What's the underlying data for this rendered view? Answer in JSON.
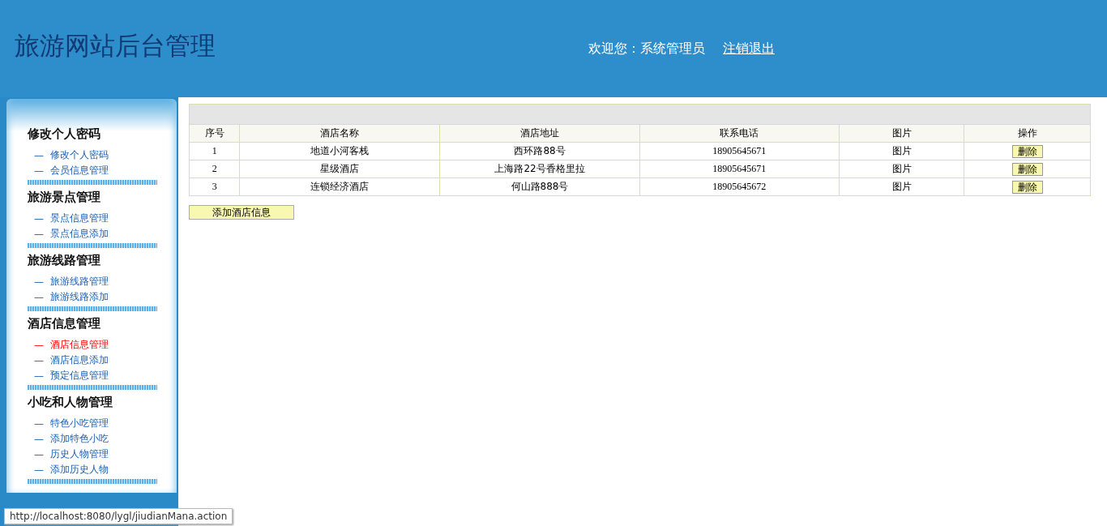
{
  "header": {
    "title": "旅游网站后台管理",
    "welcome": "欢迎您：系统管理员",
    "logout": "注销退出"
  },
  "sidebar": {
    "groups": [
      {
        "title": "修改个人密码",
        "items": [
          {
            "bullet": "—",
            "label": "修改个人密码",
            "selected": false
          },
          {
            "bullet": "—",
            "label": "会员信息管理",
            "selected": false
          }
        ]
      },
      {
        "title": "旅游景点管理",
        "items": [
          {
            "bullet": "—",
            "label": "景点信息管理",
            "selected": false
          },
          {
            "bullet": "—",
            "label": "景点信息添加",
            "selected": false
          }
        ]
      },
      {
        "title": "旅游线路管理",
        "items": [
          {
            "bullet": "—",
            "label": "旅游线路管理",
            "selected": false
          },
          {
            "bullet": "—",
            "label": "旅游线路添加",
            "selected": false
          }
        ]
      },
      {
        "title": "酒店信息管理",
        "items": [
          {
            "bullet": "—",
            "label": "酒店信息管理",
            "selected": true
          },
          {
            "bullet": "—",
            "label": "酒店信息添加",
            "selected": false
          },
          {
            "bullet": "—",
            "label": "预定信息管理",
            "selected": false
          }
        ]
      },
      {
        "title": "小吃和人物管理",
        "items": [
          {
            "bullet": "—",
            "label": "特色小吃管理",
            "selected": false
          },
          {
            "bullet": "—",
            "label": "添加特色小吃",
            "selected": false
          },
          {
            "bullet": "—",
            "label": "历史人物管理",
            "selected": false
          },
          {
            "bullet": "—",
            "label": "添加历史人物",
            "selected": false
          }
        ]
      }
    ]
  },
  "table": {
    "columns": [
      "序号",
      "酒店名称",
      "酒店地址",
      "联系电话",
      "图片",
      "操作"
    ],
    "rows": [
      {
        "cells": [
          "1",
          "地道小河客栈",
          "西环路88号",
          "18905645671",
          "图片"
        ],
        "action": "删除"
      },
      {
        "cells": [
          "2",
          "星级酒店",
          "上海路22号香格里拉",
          "18905645671",
          "图片"
        ],
        "action": "删除"
      },
      {
        "cells": [
          "3",
          "连锁经济酒店",
          "何山路888号",
          "18905645672",
          "图片"
        ],
        "action": "删除"
      }
    ]
  },
  "add_button": "添加酒店信息",
  "status_bar": "http://localhost:8080/lygl/jiudianMana.action"
}
